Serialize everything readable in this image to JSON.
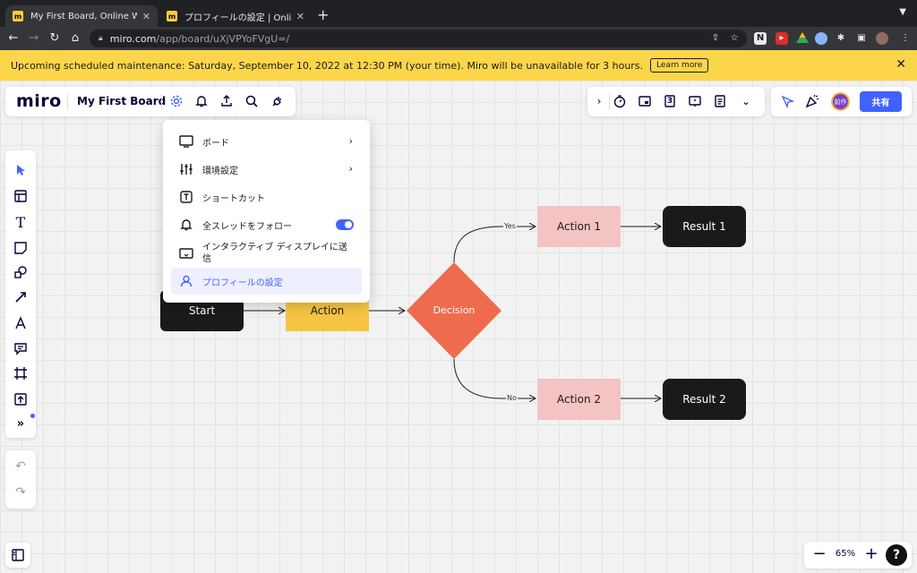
{
  "browser": {
    "tabs": [
      {
        "title": "My First Board, Online Whiteboard",
        "active": true
      },
      {
        "title": "プロフィールの設定 | Online Whiteboard",
        "active": false
      }
    ],
    "url_host": "miro.com",
    "url_path": "/app/board/uXjVPYoFVgU=/"
  },
  "banner": {
    "text": "Upcoming scheduled maintenance: Saturday, September 10, 2022 at 12:30 PM (your time). Miro will be unavailable for 3 hours.",
    "learn_more": "Learn more",
    "color": "#fcd64a"
  },
  "header": {
    "logo": "miro",
    "board_name": "My First Board",
    "icons": [
      "settings-icon",
      "notification-icon",
      "upload-icon",
      "search-icon",
      "plugin-icon"
    ]
  },
  "right_tools": {
    "icons": [
      "collapse-icon",
      "timer-icon",
      "card-icon",
      "counter-icon",
      "presentation-icon",
      "notes-icon",
      "more-icon"
    ],
    "counter_label": "3"
  },
  "collab": {
    "avatar_text": "前作",
    "share_label": "共有",
    "accent": "#4262ff"
  },
  "left_tools": [
    "select-icon",
    "template-icon",
    "text-icon",
    "sticky-note-icon",
    "shapes-icon",
    "connector-icon",
    "pen-icon",
    "comment-icon",
    "frame-icon",
    "upload-icon",
    "more-tools-icon"
  ],
  "settings_menu": {
    "items": [
      {
        "label": "ボード",
        "icon": "board-icon",
        "has_submenu": true
      },
      {
        "label": "環境設定",
        "icon": "preferences-icon",
        "has_submenu": true
      },
      {
        "label": "ショートカット",
        "icon": "shortcut-icon"
      },
      {
        "label": "全スレッドをフォロー",
        "icon": "bell-icon",
        "toggle_on": true
      },
      {
        "label": "インタラクティブ ディスプレイに送信",
        "icon": "display-icon"
      },
      {
        "label": "プロフィールの設定",
        "icon": "profile-icon",
        "selected": true
      }
    ]
  },
  "flowchart": {
    "nodes": {
      "start": "Start",
      "action": "Action",
      "decision": "Decision",
      "action1": "Action 1",
      "action2": "Action 2",
      "result1": "Result 1",
      "result2": "Result 2"
    },
    "edge_labels": {
      "yes": "Yes",
      "no": "No"
    },
    "colors": {
      "dark": "#1a1a1a",
      "action": "#f7c544",
      "decision": "#ee6c4d",
      "pink": "#f4c3c3"
    }
  },
  "zoom": {
    "value": "65%",
    "help": "?"
  }
}
